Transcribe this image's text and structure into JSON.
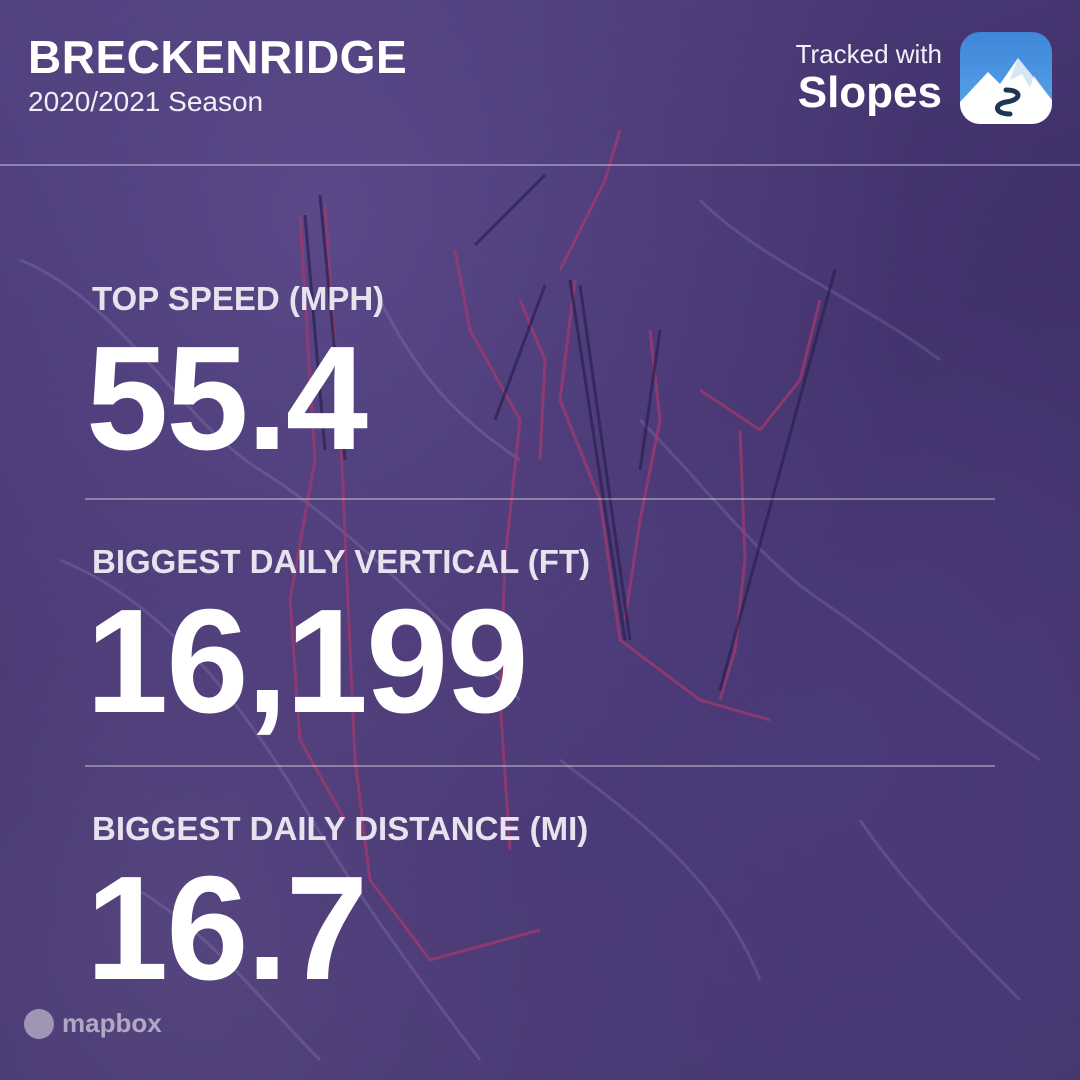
{
  "header": {
    "resort_name": "BRECKENRIDGE",
    "season": "2020/2021 Season"
  },
  "brand": {
    "tracked_label": "Tracked with",
    "app_name": "Slopes"
  },
  "stats": [
    {
      "label": "TOP SPEED (MPH)",
      "value": "55.4"
    },
    {
      "label": "BIGGEST DAILY VERTICAL (FT)",
      "value": "16,199"
    },
    {
      "label": "BIGGEST DAILY DISTANCE (MI)",
      "value": "16.7"
    }
  ],
  "map": {
    "attribution": "mapbox"
  },
  "colors": {
    "background": "#46376f",
    "track": "#a03a6e",
    "lift": "#2a2050",
    "text": "#ffffff"
  }
}
